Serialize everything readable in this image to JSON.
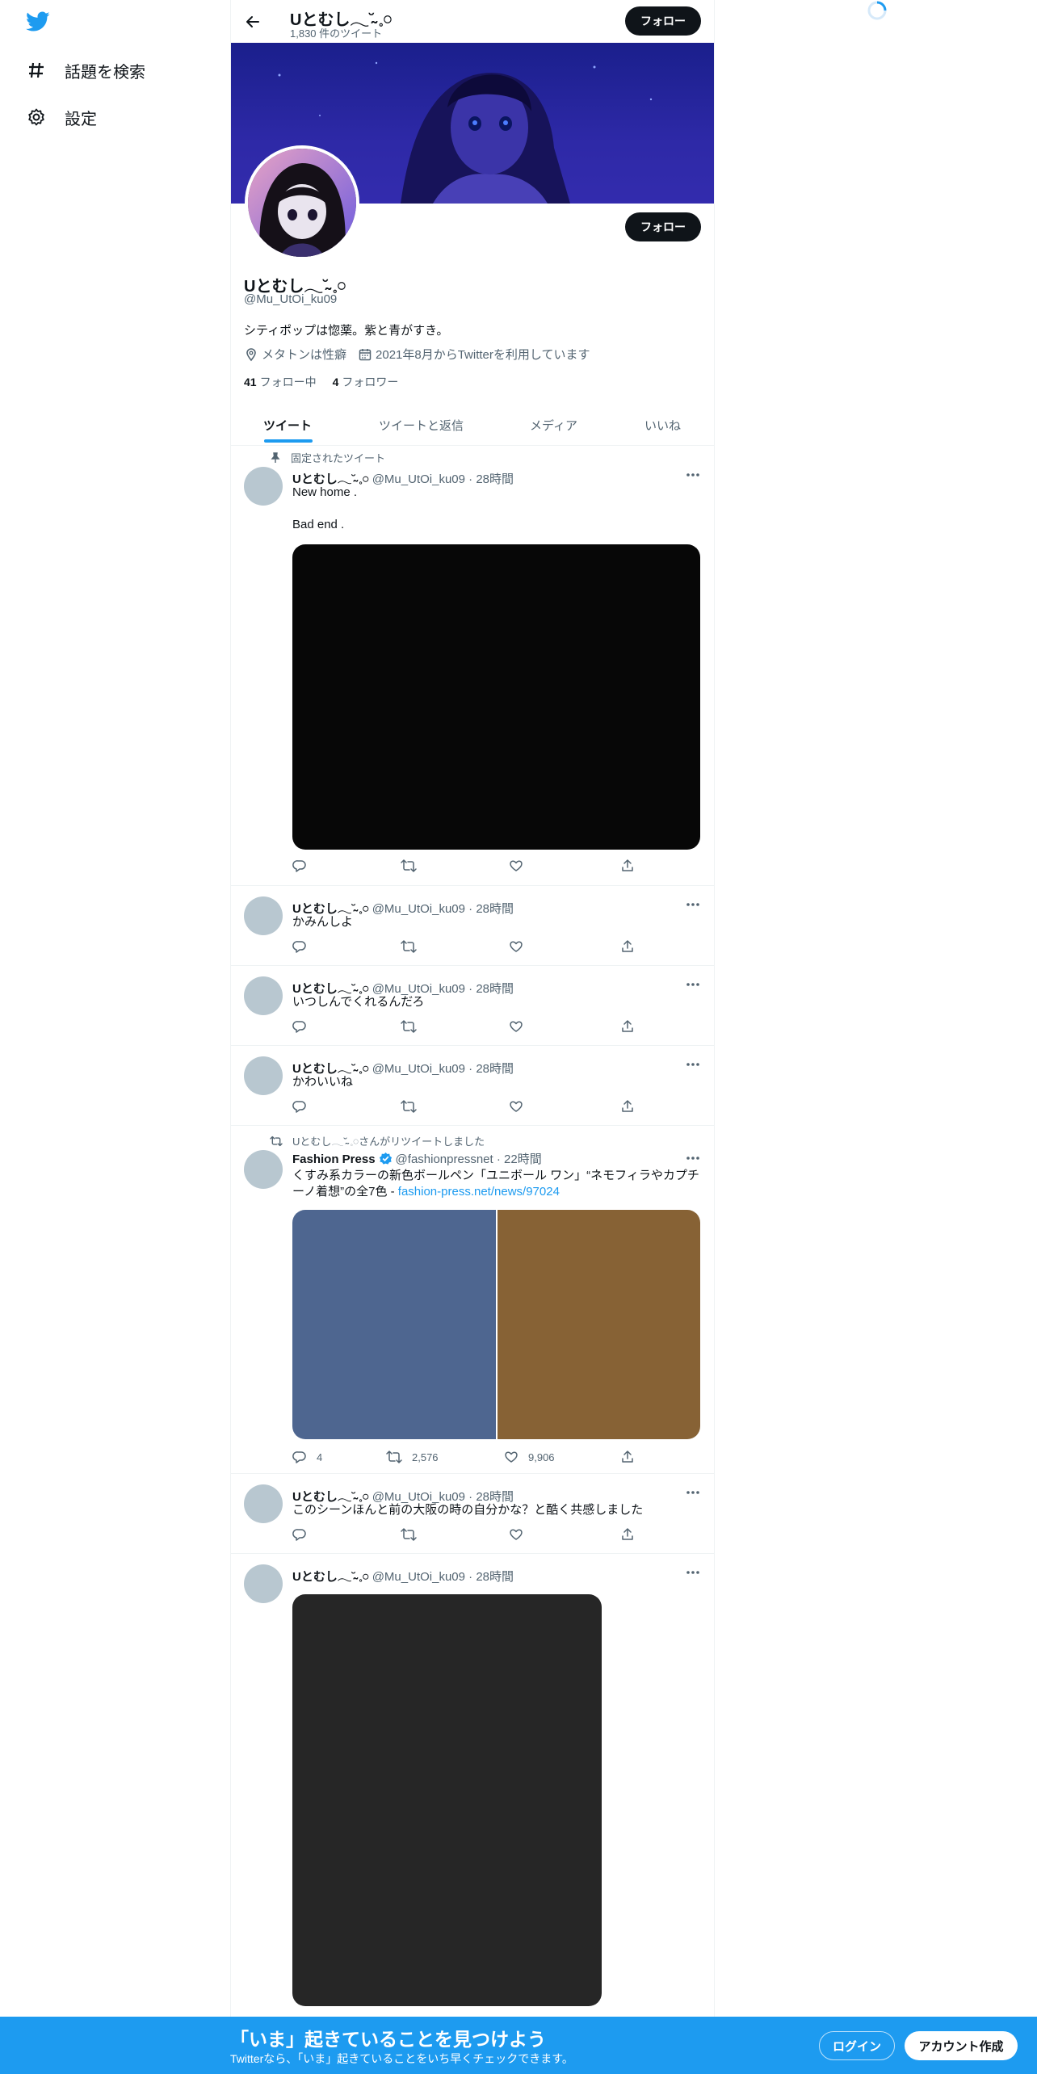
{
  "colors": {
    "accent": "#1d9bf0",
    "text": "#0f1419",
    "muted": "#536471",
    "verified": "#1d9bf0"
  },
  "sidebar": {
    "logo_icon": "twitter-bird-icon",
    "items": [
      {
        "icon": "hashtag-icon",
        "label": "話題を検索"
      },
      {
        "icon": "gear-icon",
        "label": "設定"
      }
    ]
  },
  "header": {
    "title": "Uとむし𓂃˘̴̴̴ 𓈒𓏸",
    "tweet_count": "1,830 件のツイート",
    "follow_label": "フォロー"
  },
  "profile": {
    "name": "Uとむし𓂃˘̴̴̴ 𓈒𓏸",
    "handle": "@Mu_UtOi_ku09",
    "bio": "シティポップは惚薬。紫と青がすき。",
    "location": "メタトンは性癖",
    "joined": "2021年8月からTwitterを利用しています",
    "following_count": "41",
    "following_label": "フォロー中",
    "followers_count": "4",
    "followers_label": "フォロワー",
    "follow_label": "フォロー"
  },
  "tabs": [
    {
      "label": "ツイート",
      "active": true
    },
    {
      "label": "ツイートと返信",
      "active": false
    },
    {
      "label": "メディア",
      "active": false
    },
    {
      "label": "いいね",
      "active": false
    }
  ],
  "tweets": [
    {
      "context": "固定されたツイート",
      "name": "Uとむし𓂃˘̴̴̴ 𓈒𓏸",
      "handle": "@Mu_UtOi_ku09",
      "time": "28時間",
      "line1": "New home .",
      "line2": "Bad end .",
      "has_media": true
    },
    {
      "name": "Uとむし𓂃˘̴̴̴ 𓈒𓏸",
      "handle": "@Mu_UtOi_ku09",
      "time": "28時間",
      "text": "かみんしよ"
    },
    {
      "name": "Uとむし𓂃˘̴̴̴ 𓈒𓏸",
      "handle": "@Mu_UtOi_ku09",
      "time": "28時間",
      "text": "いつしんでくれるんだろ"
    },
    {
      "name": "Uとむし𓂃˘̴̴̴ 𓈒𓏸",
      "handle": "@Mu_UtOi_ku09",
      "time": "28時間",
      "text": "かわいいね"
    },
    {
      "context": "Uとむし𓂃˘̴̴̴ 𓈒𓏸さんがリツイートしました",
      "name": "Fashion Press",
      "verified": true,
      "handle": "@fashionpressnet",
      "time": "22時間",
      "text": "くすみ系カラーの新色ボールペン「ユニボール ワン」“ネモフィラやカプチーノ着想”の全7色 - ",
      "link": "fashion-press.net/news/97024",
      "reply_count": "4",
      "retweet_count": "2,576",
      "like_count": "9,906",
      "media_colors": [
        "#4e6690",
        "#876235"
      ]
    },
    {
      "name": "Uとむし𓂃˘̴̴̴ 𓈒𓏸",
      "handle": "@Mu_UtOi_ku09",
      "time": "28時間",
      "text": "このシーンほんと前の大阪の時の自分かな？と酷く共感しました"
    },
    {
      "name": "Uとむし𓂃˘̴̴̴ 𓈒𓏸",
      "handle": "@Mu_UtOi_ku09",
      "time": "28時間",
      "has_media": true
    }
  ],
  "bottom_bar": {
    "title": "「いま」起きていることを見つけよう",
    "subtitle": "Twitterなら、「いま」起きていることをいち早くチェックできます。",
    "login": "ログイン",
    "signup": "アカウント作成"
  }
}
